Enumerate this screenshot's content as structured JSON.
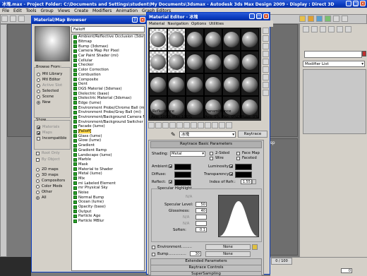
{
  "app": {
    "title": "冰塊.max    - Project Folder: C:\\Documents and Settings\\student\\My Documents\\3dsmax    - Autodesk 3ds Max Design 2009    - Display : Direct 3D",
    "menu": [
      "Edit",
      "Tools",
      "Group",
      "Views",
      "Create",
      "Modifiers",
      "Animation",
      "Graph Editors"
    ],
    "menu_first": "File"
  },
  "viewports": {
    "top_right_label": "op",
    "persp_label": "Persp"
  },
  "command_panel": {
    "modifier_list": "Modifier List"
  },
  "browser": {
    "title": "Material/Map Browser",
    "type_field": "Falloff",
    "browse_from_title": "Browse From:",
    "browse_from": [
      {
        "label": "Mtl Library",
        "on": false,
        "disabled": false
      },
      {
        "label": "Mtl Editor",
        "on": false,
        "disabled": false
      },
      {
        "label": "Active Slot",
        "on": false,
        "disabled": true
      },
      {
        "label": "Selected",
        "on": false,
        "disabled": false
      },
      {
        "label": "Scene",
        "on": false,
        "disabled": false
      },
      {
        "label": "New",
        "on": true,
        "disabled": false
      }
    ],
    "show_title": "Show",
    "show": [
      {
        "label": "Materials",
        "on": true,
        "disabled": true
      },
      {
        "label": "Maps",
        "on": true,
        "disabled": true
      },
      {
        "label": "Incompatible",
        "on": false,
        "disabled": false
      }
    ],
    "root_only": "Root Only",
    "by_object": "By Object",
    "map_types": [
      {
        "label": "2D maps",
        "on": false
      },
      {
        "label": "3D maps",
        "on": false
      },
      {
        "label": "Compositors",
        "on": false
      },
      {
        "label": "Color Mods",
        "on": false
      },
      {
        "label": "Other",
        "on": false
      },
      {
        "label": "All",
        "on": true
      }
    ],
    "items": [
      "Ambient/Reflective Occlusion (3dsm",
      "Bitmap",
      "Bump (3dsmax)",
      "Camera Map Per Pixel",
      "Car Paint Shader (mi)",
      "Cellular",
      "Checker",
      "Color Correction",
      "Combustion",
      "Composite",
      "Dent",
      "DGS Material (3dsmax)",
      "Dielectric (base)",
      "Dielectric Material (3dsmax)",
      "Edge (lume)",
      "Environment Probe/Chrome Ball (mi)",
      "Environment Probe/Gray Ball (mi)",
      "Environment/Background Camera M",
      "Environment/Background Switcher (",
      "Facade (lume)",
      "Falloff",
      "Glass (lume)",
      "Glow (lume)",
      "Gradient",
      "Gradient Ramp",
      "Landscape (lume)",
      "Marble",
      "Mask",
      "Material to Shader",
      "Metal (lume)",
      "Mix",
      "mi Labeled Element",
      "mr Physical Sky",
      "Noise",
      "Normal Bump",
      "Ocean (lume)",
      "Opacity (base)",
      "Output",
      "Particle Age",
      "Particle MBlur"
    ],
    "selected_index": 20
  },
  "mat_editor": {
    "title": "Material Editor - 冰塊",
    "menu": [
      "Material",
      "Navigation",
      "Options",
      "Utilities"
    ],
    "reflectance_label": "Reflectance",
    "reflectance_values": "Avg: 100% Max:100%",
    "transmittance_label": "Transmittance",
    "transmittance_values": "Avg:      0% Max:     0%",
    "diffuse_values": "Diffuse:      0%",
    "name_value": "冰塊",
    "type_button": "Raytrace",
    "basic_params": "Raytrace Basic Parameters",
    "shading_label": "Shading:",
    "shading_value": "Metal",
    "two_sided": "2-Sided",
    "wire": "Wire",
    "face_map": "Face Map",
    "faceted": "Faceted",
    "ambient": "Ambient:",
    "diffuse": "Diffuse:",
    "reflect": "Reflect:",
    "luminosity": "Luminosity:",
    "transparency": "Transparency:",
    "ior_label": "Index of Refr.:",
    "ior_value": "1.55",
    "specular_title": "Specular Highlight",
    "spec_level_label": "Specular Level:",
    "spec_level": "50",
    "gloss_label": "Glossiness:",
    "gloss": "40",
    "soften_label": "Soften:",
    "soften": "0.1",
    "na": "N/A",
    "environment": "Environment.........",
    "bump": "Bump...............",
    "bump_amount": "30",
    "none": "None",
    "rollups": [
      "Extended Parameters",
      "Raytrace Controls",
      "SuperSampling"
    ]
  },
  "status": {
    "frame": "0",
    "time_display": "0 / 100"
  }
}
